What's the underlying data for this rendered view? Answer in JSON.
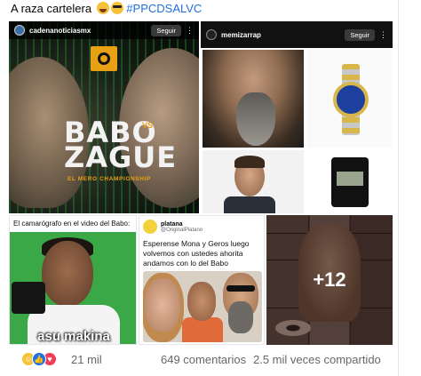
{
  "caption": {
    "text": "A raza cartelera",
    "hashtag": "#PPCDSALVC",
    "emojis": [
      "laughing-face-icon",
      "sunglasses-face-icon"
    ]
  },
  "tiles": {
    "t1": {
      "handle": "cadenanoticiasmx",
      "follow": "Seguir",
      "title_line1": "BABO",
      "vs": "VS",
      "title_line2": "ZAGUE",
      "subtitle": "EL MERO CHAMPIONSHIP"
    },
    "t2": {
      "handle": "memizarrap",
      "follow": "Seguir"
    },
    "t3": {
      "caption": "El camarógrafo en el video del Babo:",
      "meme_text": "asu makina"
    },
    "t4": {
      "name": "platana",
      "at": "@OriginalPlatano",
      "text": "Esperense Mona y Geros luego volvemos con ustedes ahorita andamos con lo del Babo"
    },
    "t5": {
      "more": "+12"
    }
  },
  "footer": {
    "reactions": [
      "laugh-reaction-icon",
      "like-reaction-icon",
      "love-reaction-icon"
    ],
    "reaction_count": "21 mil",
    "comments": "649 comentarios",
    "shares": "2.5 mil veces compartido"
  }
}
